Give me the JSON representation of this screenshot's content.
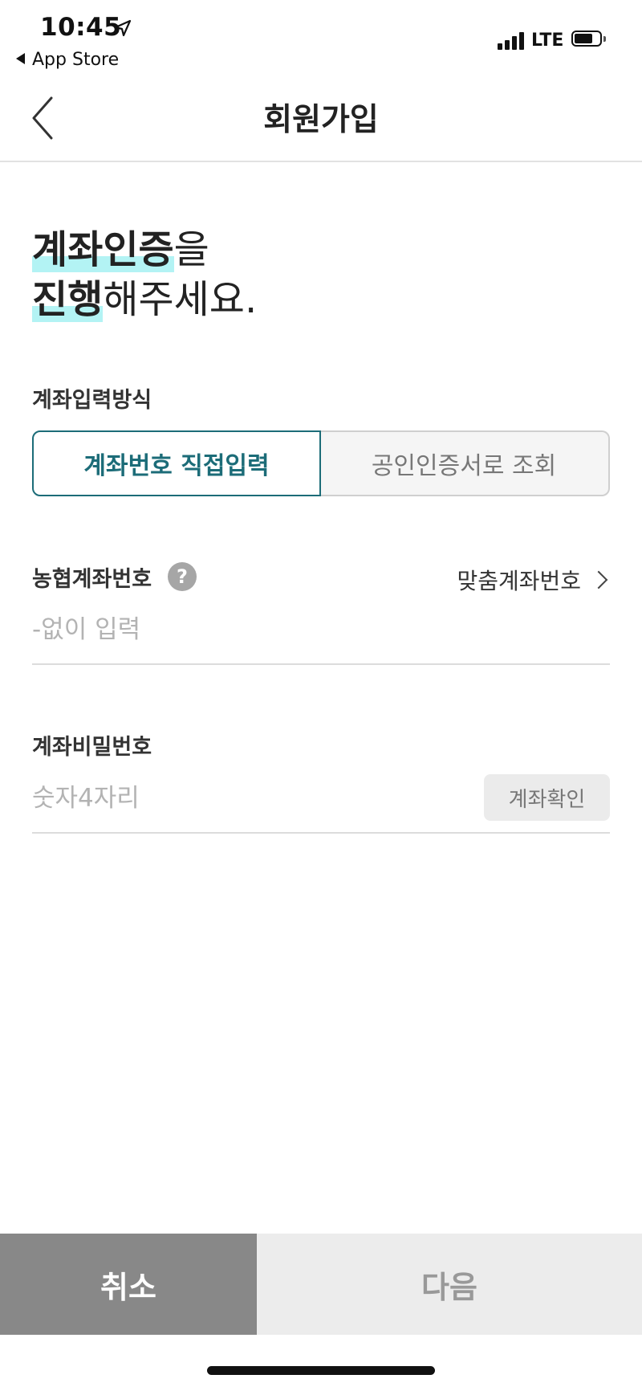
{
  "status_bar": {
    "time": "10:45",
    "back_to_app": "App Store",
    "network": "LTE"
  },
  "header": {
    "title": "회원가입"
  },
  "heading": {
    "line1_highlight": "계좌인증",
    "line1_rest": "을",
    "line2_highlight": "진행",
    "line2_rest": "해주세요."
  },
  "account_method": {
    "label": "계좌입력방식",
    "options": [
      {
        "label": "계좌번호 직접입력",
        "selected": true
      },
      {
        "label": "공인인증서로 조회",
        "selected": false
      }
    ]
  },
  "account_number": {
    "label": "농협계좌번호",
    "help_symbol": "?",
    "custom_link": "맞춤계좌번호",
    "placeholder": "-없이 입력",
    "value": ""
  },
  "account_password": {
    "label": "계좌비밀번호",
    "placeholder": "숫자4자리",
    "value": "",
    "confirm_button": "계좌확인"
  },
  "footer": {
    "cancel_label": "취소",
    "next_label": "다음"
  },
  "colors": {
    "accent": "#1c6c78",
    "highlight": "#b3f3f4",
    "cancel_bg": "#888888",
    "next_bg": "#ececec"
  }
}
